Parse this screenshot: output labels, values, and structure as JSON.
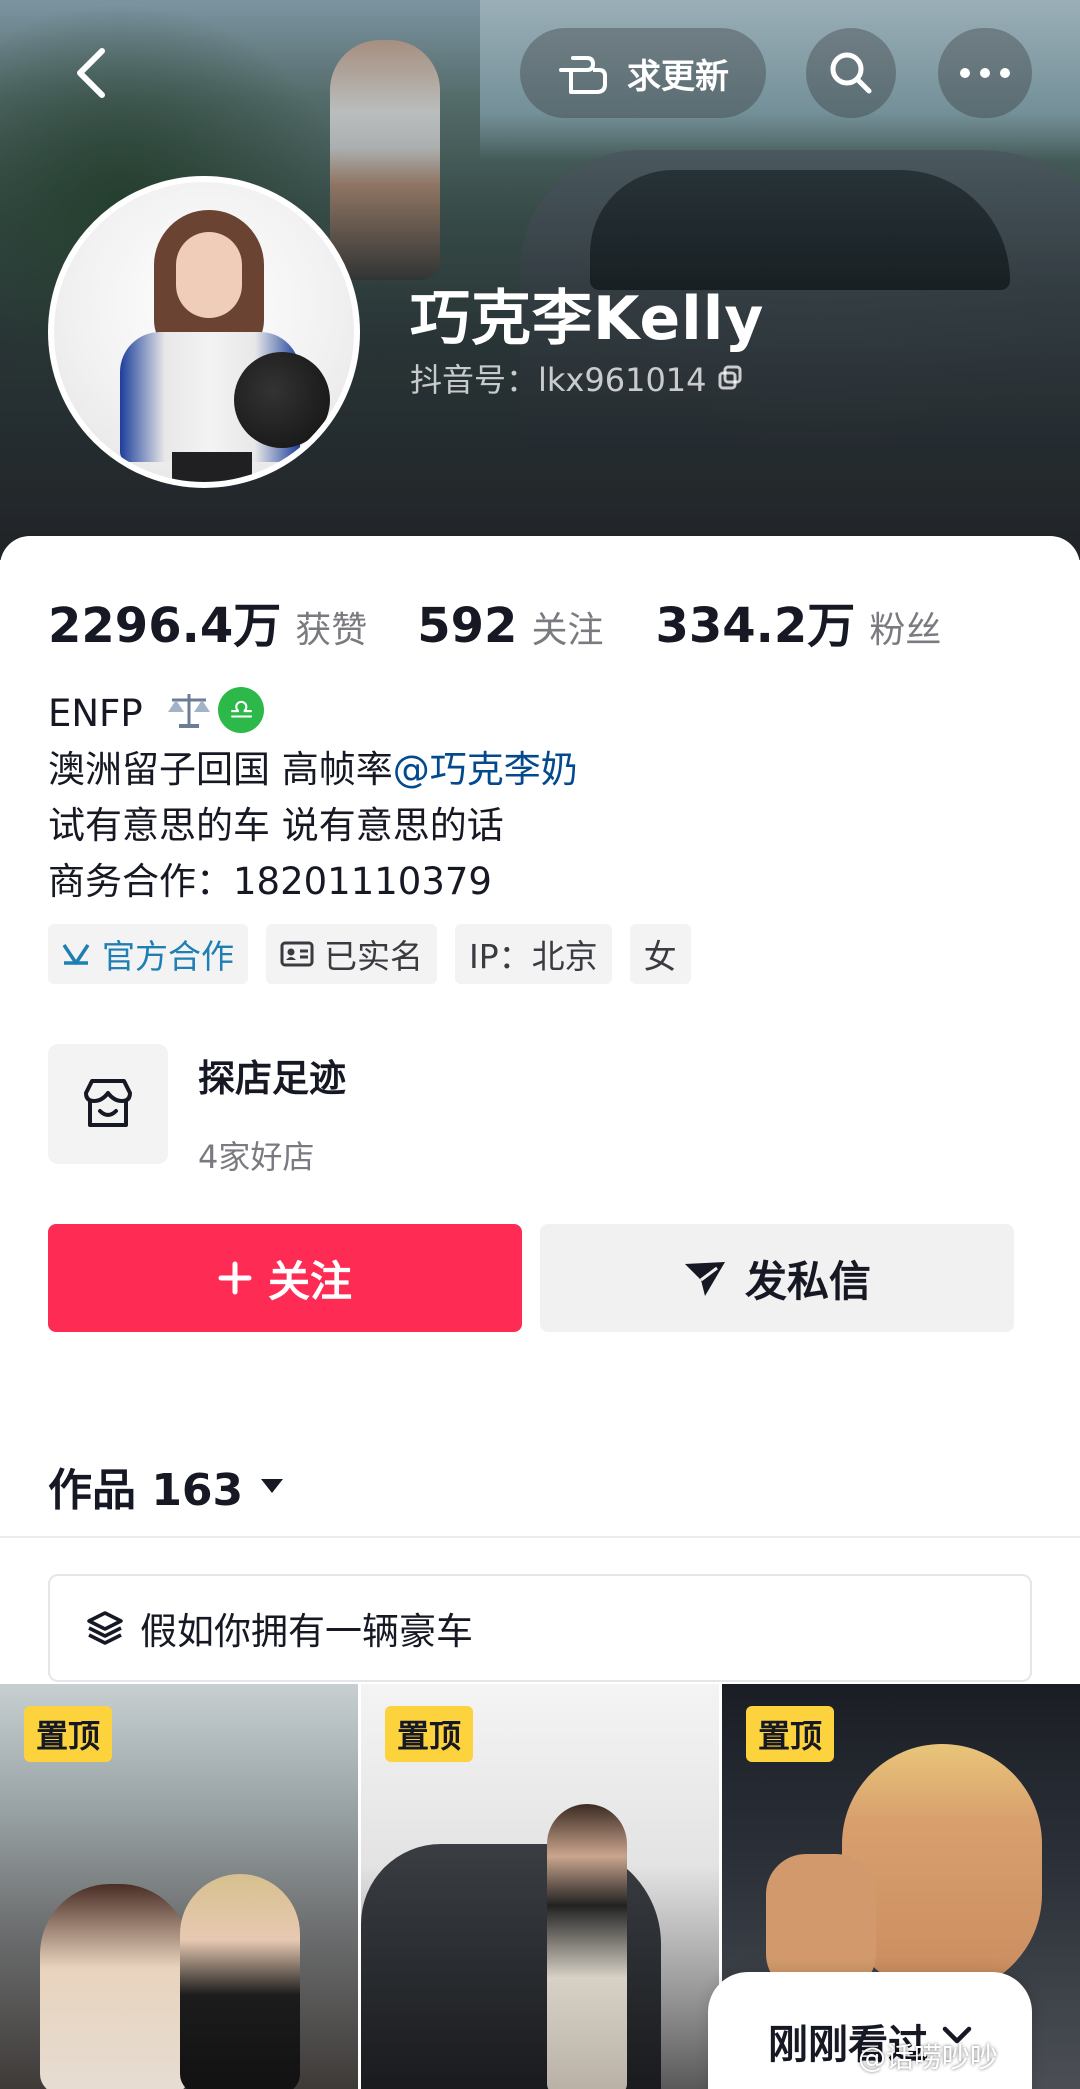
{
  "header": {
    "update_label": "求更新",
    "nickname": "巧克李Kelly",
    "douyin_id": "抖音号：lkx961014"
  },
  "stats": {
    "likes_value": "2296.4万",
    "likes_label": "获赞",
    "following_value": "592",
    "following_label": "关注",
    "followers_value": "334.2万",
    "followers_label": "粉丝"
  },
  "bio": {
    "line1": "ENFP",
    "zodiac_icon": "♎",
    "line2_prefix": "澳洲留子回国 高帧率",
    "line2_mention": "@巧克李奶",
    "line3": "试有意思的车 说有意思的话",
    "line4": "商务合作：18201110379"
  },
  "tags": [
    {
      "label": "官方合作",
      "icon": "official-cooperation-icon"
    },
    {
      "label": "已实名",
      "icon": "id-card-icon"
    },
    {
      "label": "IP：北京"
    },
    {
      "label": "女"
    }
  ],
  "shop": {
    "title": "探店足迹",
    "subtitle": "4家好店",
    "icon": "store-icon"
  },
  "actions": {
    "follow_label": "关注",
    "message_label": "发私信"
  },
  "works": {
    "label": "作品 163"
  },
  "playlist": {
    "label": "假如你拥有一辆豪车",
    "icon": "layers-icon"
  },
  "videos": [
    {
      "badge": "置顶"
    },
    {
      "badge": "置顶"
    },
    {
      "badge": "置顶"
    }
  ],
  "recent": {
    "label": "刚刚看过"
  },
  "watermark": "@话唠吵吵",
  "colors": {
    "follow_button": "#fe2c55",
    "mention": "#04498d",
    "official_tag": "#1e7fb3",
    "pin_badge": "#fdd33d"
  }
}
